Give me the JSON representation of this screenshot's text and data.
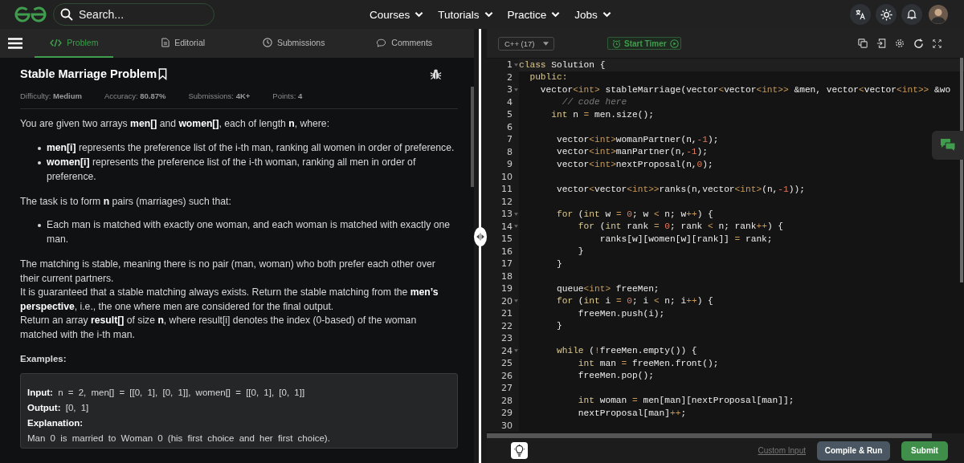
{
  "nav": {
    "search": {
      "placeholder": "Search..."
    },
    "menus": [
      {
        "label": "Courses"
      },
      {
        "label": "Tutorials"
      },
      {
        "label": "Practice"
      },
      {
        "label": "Jobs"
      }
    ]
  },
  "tabs": [
    {
      "label": "Problem",
      "selected": true
    },
    {
      "label": "Editorial",
      "selected": false
    },
    {
      "label": "Submissions",
      "selected": false
    },
    {
      "label": "Comments",
      "selected": false
    }
  ],
  "problem": {
    "title": "Stable Marriage Problem",
    "meta": [
      {
        "label": "Difficulty:",
        "value": "Medium"
      },
      {
        "label": "Accuracy:",
        "value": "80.87%"
      },
      {
        "label": "Submissions:",
        "value": "4K+"
      },
      {
        "label": "Points:",
        "value": "4"
      }
    ],
    "body": [
      {
        "kind": "para",
        "lines": [
          "You are given two arrays **men[]** and **women[]**, each of length **n**, where:"
        ]
      },
      {
        "kind": "bullets",
        "items": [
          "**men[i]** represents the preference list of the i-th man, ranking all women in order of preference.",
          "**women[i]** represents the preference list of the i-th woman, ranking all men in order of preference."
        ]
      },
      {
        "kind": "para",
        "lines": [
          "The task is to form **n** pairs (marriages) such that:"
        ]
      },
      {
        "kind": "bullets",
        "items": [
          "Each man is matched with exactly one woman, and each woman is matched with exactly one man."
        ]
      },
      {
        "kind": "para",
        "lines": [
          "The matching is stable, meaning there is no pair (man, woman) who both prefer each other over their current partners.",
          "It is guaranteed that a stable matching always exists. Return the stable matching from the **men’s perspective**, i.e., the one where men are considered for the final output.",
          "Return an array **result[]** of size **n**, where result[i] denotes the index (0-based) of the woman matched with the i-th man."
        ]
      },
      {
        "kind": "heading",
        "lines": [
          "Examples:"
        ]
      }
    ],
    "example": [
      "**Input:** n = 2, men[] = [[0, 1], [0, 1]], women[] = [[0, 1], [0, 1]]",
      "**Output:** [0, 1]",
      "**Explanation:**",
      "Man 0 is married to Woman 0 (his first choice and her first choice)."
    ]
  },
  "editor": {
    "language": "C++ (17)",
    "timer": "Start Timer",
    "lines": [
      {
        "number": "1",
        "active": true,
        "foldable": true,
        "tokens": [
          {
            "kind": "keyword",
            "text": "class"
          },
          {
            "kind": "plain",
            "text": " Solution {"
          }
        ]
      },
      {
        "number": "2",
        "active": false,
        "foldable": false,
        "tokens": [
          {
            "kind": "keyword",
            "text": "  public:"
          }
        ]
      },
      {
        "number": "3",
        "active": false,
        "foldable": true,
        "tokens": [
          {
            "kind": "plain",
            "text": "    vector"
          },
          {
            "kind": "type",
            "text": "<int>"
          },
          {
            "kind": "plain",
            "text": " stableMarriage(vector"
          },
          {
            "kind": "type",
            "text": "<"
          },
          {
            "kind": "plain",
            "text": "vector"
          },
          {
            "kind": "type",
            "text": "<int>>"
          },
          {
            "kind": "plain",
            "text": " &men, vector"
          },
          {
            "kind": "type",
            "text": "<"
          },
          {
            "kind": "plain",
            "text": "vector"
          },
          {
            "kind": "type",
            "text": "<int>>"
          },
          {
            "kind": "plain",
            "text": " &wo"
          }
        ]
      },
      {
        "number": "4",
        "active": false,
        "foldable": false,
        "tokens": [
          {
            "kind": "comment",
            "text": "        // code here"
          }
        ]
      },
      {
        "number": "5",
        "active": false,
        "foldable": false,
        "tokens": [
          {
            "kind": "keyword",
            "text": "      int"
          },
          {
            "kind": "plain",
            "text": " n "
          },
          {
            "kind": "type",
            "text": "="
          },
          {
            "kind": "plain",
            "text": " men.size();"
          }
        ]
      },
      {
        "number": "6",
        "active": false,
        "foldable": false
      },
      {
        "number": "7",
        "active": false,
        "foldable": false,
        "tokens": [
          {
            "kind": "plain",
            "text": "       vector"
          },
          {
            "kind": "type",
            "text": "<int>"
          },
          {
            "kind": "plain",
            "text": "womanPartner(n,"
          },
          {
            "kind": "number",
            "text": "-1"
          },
          {
            "kind": "plain",
            "text": ");"
          }
        ]
      },
      {
        "number": "8",
        "active": false,
        "foldable": false,
        "tokens": [
          {
            "kind": "plain",
            "text": "       vector"
          },
          {
            "kind": "type",
            "text": "<int>"
          },
          {
            "kind": "plain",
            "text": "manPartner(n,"
          },
          {
            "kind": "number",
            "text": "-1"
          },
          {
            "kind": "plain",
            "text": ");"
          }
        ]
      },
      {
        "number": "9",
        "active": false,
        "foldable": false,
        "tokens": [
          {
            "kind": "plain",
            "text": "       vector"
          },
          {
            "kind": "type",
            "text": "<int>"
          },
          {
            "kind": "plain",
            "text": "nextProposal(n,"
          },
          {
            "kind": "number",
            "text": "0"
          },
          {
            "kind": "plain",
            "text": ");"
          }
        ]
      },
      {
        "number": "10",
        "active": false,
        "foldable": false
      },
      {
        "number": "11",
        "active": false,
        "foldable": false,
        "tokens": [
          {
            "kind": "plain",
            "text": "       vector"
          },
          {
            "kind": "type",
            "text": "<"
          },
          {
            "kind": "plain",
            "text": "vector"
          },
          {
            "kind": "type",
            "text": "<int>>"
          },
          {
            "kind": "plain",
            "text": "ranks(n,vector"
          },
          {
            "kind": "type",
            "text": "<int>"
          },
          {
            "kind": "plain",
            "text": "(n,"
          },
          {
            "kind": "number",
            "text": "-1"
          },
          {
            "kind": "plain",
            "text": "));"
          }
        ]
      },
      {
        "number": "12",
        "active": false,
        "foldable": false
      },
      {
        "number": "13",
        "active": false,
        "foldable": true,
        "tokens": [
          {
            "kind": "keyword",
            "text": "       for"
          },
          {
            "kind": "plain",
            "text": " ("
          },
          {
            "kind": "keyword",
            "text": "int"
          },
          {
            "kind": "plain",
            "text": " w "
          },
          {
            "kind": "type",
            "text": "= "
          },
          {
            "kind": "number",
            "text": "0"
          },
          {
            "kind": "plain",
            "text": "; w "
          },
          {
            "kind": "type",
            "text": "<"
          },
          {
            "kind": "plain",
            "text": " n; w"
          },
          {
            "kind": "type",
            "text": "++"
          },
          {
            "kind": "plain",
            "text": ") {"
          }
        ]
      },
      {
        "number": "14",
        "active": false,
        "foldable": true,
        "tokens": [
          {
            "kind": "keyword",
            "text": "           for"
          },
          {
            "kind": "plain",
            "text": " ("
          },
          {
            "kind": "keyword",
            "text": "int"
          },
          {
            "kind": "plain",
            "text": " rank "
          },
          {
            "kind": "type",
            "text": "= "
          },
          {
            "kind": "number",
            "text": "0"
          },
          {
            "kind": "plain",
            "text": "; rank "
          },
          {
            "kind": "type",
            "text": "<"
          },
          {
            "kind": "plain",
            "text": " n; rank"
          },
          {
            "kind": "type",
            "text": "++"
          },
          {
            "kind": "plain",
            "text": ") {"
          }
        ]
      },
      {
        "number": "15",
        "active": false,
        "foldable": false,
        "tokens": [
          {
            "kind": "plain",
            "text": "               ranks[w][women[w][rank]] "
          },
          {
            "kind": "type",
            "text": "="
          },
          {
            "kind": "plain",
            "text": " rank;"
          }
        ]
      },
      {
        "number": "16",
        "active": false,
        "foldable": false,
        "tokens": [
          {
            "kind": "plain",
            "text": "           }"
          }
        ]
      },
      {
        "number": "17",
        "active": false,
        "foldable": false,
        "tokens": [
          {
            "kind": "plain",
            "text": "       }"
          }
        ]
      },
      {
        "number": "18",
        "active": false,
        "foldable": false
      },
      {
        "number": "19",
        "active": false,
        "foldable": false,
        "tokens": [
          {
            "kind": "plain",
            "text": "       queue"
          },
          {
            "kind": "type",
            "text": "<int>"
          },
          {
            "kind": "plain",
            "text": " freeMen;"
          }
        ]
      },
      {
        "number": "20",
        "active": false,
        "foldable": true,
        "tokens": [
          {
            "kind": "keyword",
            "text": "       for"
          },
          {
            "kind": "plain",
            "text": " ("
          },
          {
            "kind": "keyword",
            "text": "int"
          },
          {
            "kind": "plain",
            "text": " i "
          },
          {
            "kind": "type",
            "text": "= "
          },
          {
            "kind": "number",
            "text": "0"
          },
          {
            "kind": "plain",
            "text": "; i "
          },
          {
            "kind": "type",
            "text": "<"
          },
          {
            "kind": "plain",
            "text": " n; i"
          },
          {
            "kind": "type",
            "text": "++"
          },
          {
            "kind": "plain",
            "text": ") {"
          }
        ]
      },
      {
        "number": "21",
        "active": false,
        "foldable": false,
        "tokens": [
          {
            "kind": "plain",
            "text": "           freeMen.push(i);"
          }
        ]
      },
      {
        "number": "22",
        "active": false,
        "foldable": false,
        "tokens": [
          {
            "kind": "plain",
            "text": "       }"
          }
        ]
      },
      {
        "number": "23",
        "active": false,
        "foldable": false
      },
      {
        "number": "24",
        "active": false,
        "foldable": true,
        "tokens": [
          {
            "kind": "keyword",
            "text": "       while"
          },
          {
            "kind": "plain",
            "text": " ("
          },
          {
            "kind": "type",
            "text": "!"
          },
          {
            "kind": "plain",
            "text": "freeMen.empty()) {"
          }
        ]
      },
      {
        "number": "25",
        "active": false,
        "foldable": false,
        "tokens": [
          {
            "kind": "keyword",
            "text": "           int"
          },
          {
            "kind": "plain",
            "text": " man "
          },
          {
            "kind": "type",
            "text": "="
          },
          {
            "kind": "plain",
            "text": " freeMen.front();"
          }
        ]
      },
      {
        "number": "26",
        "active": false,
        "foldable": false,
        "tokens": [
          {
            "kind": "plain",
            "text": "           freeMen.pop();"
          }
        ]
      },
      {
        "number": "27",
        "active": false,
        "foldable": false
      },
      {
        "number": "28",
        "active": false,
        "foldable": false,
        "tokens": [
          {
            "kind": "keyword",
            "text": "           int"
          },
          {
            "kind": "plain",
            "text": " woman "
          },
          {
            "kind": "type",
            "text": "="
          },
          {
            "kind": "plain",
            "text": " men[man][nextProposal[man]];"
          }
        ]
      },
      {
        "number": "29",
        "active": false,
        "foldable": false,
        "tokens": [
          {
            "kind": "plain",
            "text": "           nextProposal[man]"
          },
          {
            "kind": "type",
            "text": "++"
          },
          {
            "kind": "plain",
            "text": ";"
          }
        ]
      },
      {
        "number": "30",
        "active": false,
        "foldable": false
      }
    ]
  },
  "footer": {
    "custom_input": "Custom Input",
    "buttons": [
      {
        "label": "Compile & Run",
        "kind": "secondary"
      },
      {
        "label": "Submit",
        "kind": "primary"
      }
    ]
  }
}
